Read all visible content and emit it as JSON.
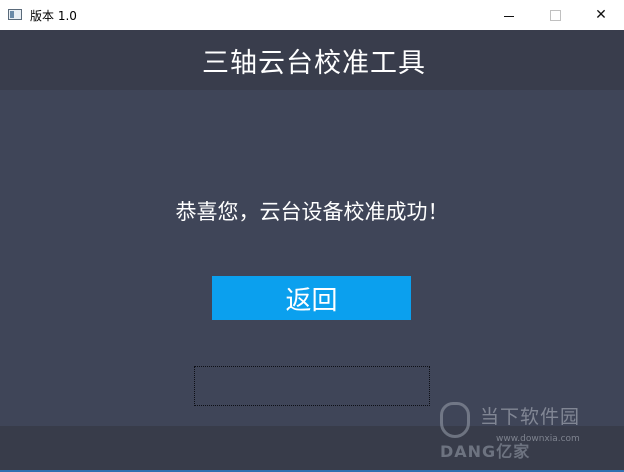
{
  "window": {
    "title": "版本 1.0",
    "minimize_icon": "minimize-icon",
    "maximize_icon": "maximize-icon",
    "close_icon": "close-icon",
    "close_glyph": "✕"
  },
  "header": {
    "title": "三轴云台校准工具"
  },
  "main": {
    "message": "恭喜您，云台设备校准成功！",
    "back_button_label": "返回",
    "accent_color": "#0ba0ee"
  },
  "watermark": {
    "site_name": "当下软件园",
    "brand": "DANG亿家",
    "url": "www.downxia.com"
  }
}
